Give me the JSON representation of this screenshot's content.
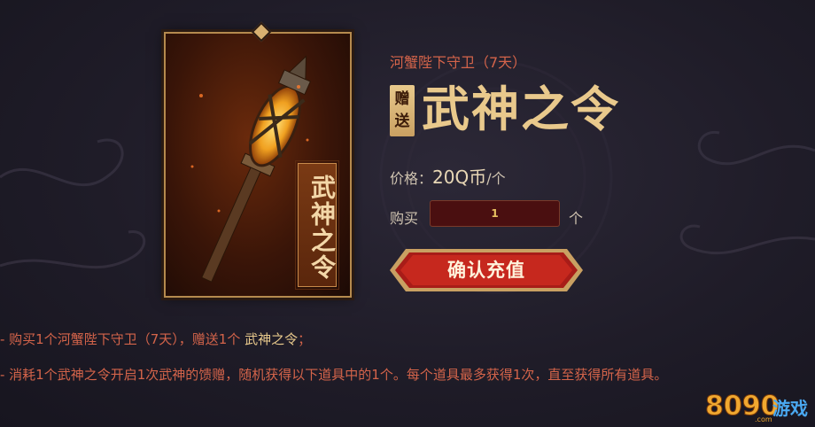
{
  "product": {
    "subtitle": "河蟹陛下守卫（7天）",
    "gift_badge": "赠送",
    "gift_title": "武神之令",
    "card_plate_text": "武神之令"
  },
  "price": {
    "label": "价格：",
    "value": "20Q币",
    "unit": "/个"
  },
  "quantity": {
    "label": "购买",
    "value": "1",
    "unit": "个"
  },
  "confirm_label": "确认充值",
  "rules": [
    {
      "prefix": "- 购买1个河蟹陛下守卫（7天），赠送1个 ",
      "highlight": "武神之令",
      "suffix": "；"
    },
    {
      "prefix": "- 消耗1个武神之令开启1次",
      "highlight": "武神",
      "suffix": "的馈赠，随机获得以下道具中的1个。每个道具最多获得1次，直至获得所有道具。"
    }
  ],
  "logo": {
    "text": "8090",
    "sub": ".com",
    "brand": "游戏"
  },
  "colors": {
    "accent_red": "#d4644a",
    "gold": "#e9c98c",
    "button_red": "#b0201a",
    "background": "#1f1c28"
  }
}
